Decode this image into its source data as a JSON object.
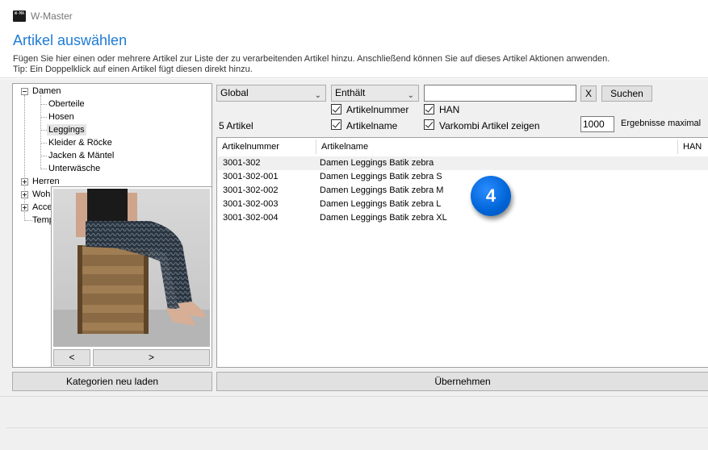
{
  "window": {
    "title": "W-Master",
    "app_icon_text": "W-MA"
  },
  "header": {
    "heading": "Artikel auswählen",
    "desc_line1": "Fügen Sie hier einen oder mehrere Artikel zur Liste der zu verarbeitenden Artikel hinzu. Anschließend können Sie auf dieses Artikel Aktionen anwenden.",
    "desc_line2": "Tip: Ein Doppelklick auf einen Artikel fügt diesen direkt hinzu."
  },
  "tree": {
    "damen": "Damen",
    "damen_children": [
      "Oberteile",
      "Hosen",
      "Leggings",
      "Kleider & Röcke",
      "Jacken & Mäntel",
      "Unterwäsche"
    ],
    "selected": "Leggings",
    "herren": "Herren",
    "wohnen": "Wohn",
    "accessoires": "Acce",
    "templates": "Temp"
  },
  "preview": {
    "prev": "<",
    "next": ">"
  },
  "filter": {
    "scope": "Global",
    "mode": "Enthält",
    "search_value": "",
    "clear": "X",
    "search_button": "Suchen",
    "cb_artikelnummer": "Artikelnummer",
    "cb_han": "HAN",
    "cb_artikelname": "Artikelname",
    "cb_varkombi": "Varkombi Artikel zeigen",
    "count_label": "5 Artikel",
    "max_value": "1000",
    "max_label": "Ergebnisse maximal"
  },
  "grid": {
    "columns": [
      "Artikelnummer",
      "Artikelname",
      "HAN"
    ],
    "rows": [
      {
        "nr": "3001-302",
        "name": "Damen Leggings  Batik zebra"
      },
      {
        "nr": "3001-302-001",
        "name": "Damen Leggings  Batik zebra S"
      },
      {
        "nr": "3001-302-002",
        "name": "Damen Leggings  Batik zebra M"
      },
      {
        "nr": "3001-302-003",
        "name": "Damen Leggings  Batik zebra L"
      },
      {
        "nr": "3001-302-004",
        "name": "Damen Leggings  Batik zebra XL"
      }
    ]
  },
  "badge": "4",
  "buttons": {
    "reload": "Kategorien neu laden",
    "apply": "Übernehmen"
  },
  "colors": {
    "accent": "#1e7bd6",
    "badge": "#0064d6"
  }
}
